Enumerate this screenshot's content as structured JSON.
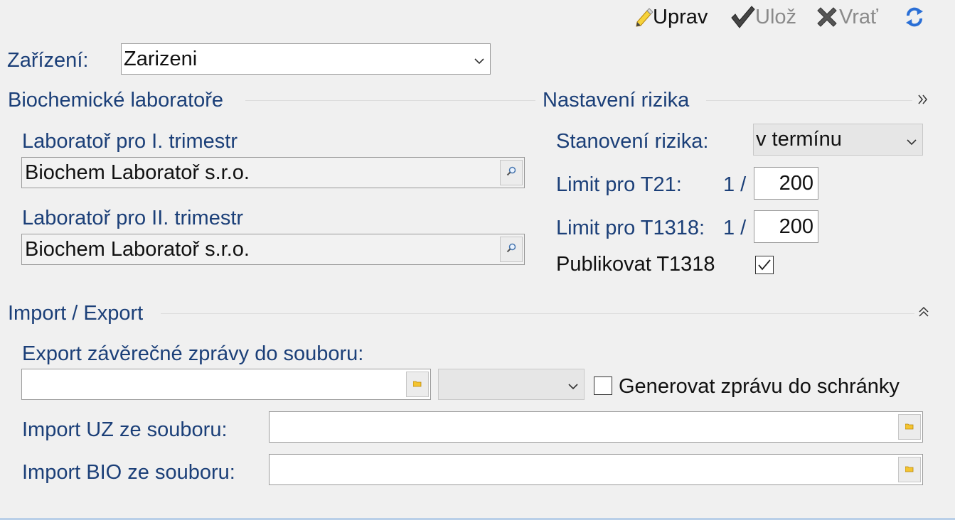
{
  "toolbar": {
    "edit_label": "Uprav",
    "save_label": "Ulož",
    "revert_label": "Vrať"
  },
  "device": {
    "label": "Zařízení:",
    "value": "Zarizeni"
  },
  "labs_section": {
    "title": "Biochemické laboratoře",
    "first_trimester_label": "Laboratoř pro I. trimestr",
    "first_trimester_value": "Biochem Laboratoř s.r.o.",
    "second_trimester_label": "Laboratoř pro II. trimestr",
    "second_trimester_value": "Biochem Laboratoř s.r.o."
  },
  "risk_section": {
    "title": "Nastavení rizika",
    "determination_label": "Stanovení rizika:",
    "determination_value": "v termínu",
    "t21_label": "Limit pro T21:",
    "t21_prefix": "1 /",
    "t21_value": "200",
    "t1318_label": "Limit pro T1318:",
    "t1318_prefix": "1 /",
    "t1318_value": "200",
    "publish_label": "Publikovat T1318",
    "publish_checked": true
  },
  "import_export": {
    "title": "Import / Export",
    "export_label": "Export závěrečné zprávy do souboru:",
    "export_path": "",
    "export_format": "",
    "clipboard_label": "Generovat zprávu do schránky",
    "clipboard_checked": false,
    "import_uz_label": "Import UZ ze souboru:",
    "import_uz_path": "",
    "import_bio_label": "Import BIO ze souboru:",
    "import_bio_path": ""
  },
  "colors": {
    "label_blue": "#1b3f78",
    "background": "#f0f0f0",
    "refresh_blue": "#2a6fd6"
  },
  "icons": {
    "edit": "pencil-icon",
    "save": "checkmark-icon",
    "revert": "cross-icon",
    "refresh": "refresh-icon",
    "expand": "double-chevron-right-icon",
    "collapse": "double-chevron-up-icon",
    "lookup": "magnifier-icon",
    "browse": "folder-icon"
  }
}
